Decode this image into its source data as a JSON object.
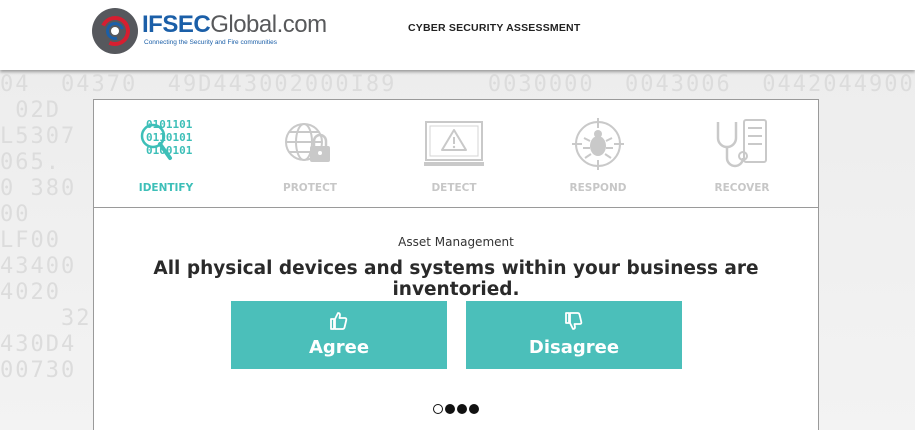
{
  "header": {
    "logo_brand": "IFSEC",
    "logo_rest": "Global.com",
    "logo_tagline": "Connecting the Security and Fire communities",
    "title": "CYBER SECURITY ASSESSMENT"
  },
  "steps": [
    {
      "label": "IDENTIFY",
      "icon": "binary-magnifier-icon",
      "active": true
    },
    {
      "label": "PROTECT",
      "icon": "globe-lock-icon",
      "active": false
    },
    {
      "label": "DETECT",
      "icon": "monitor-warning-icon",
      "active": false
    },
    {
      "label": "RESPOND",
      "icon": "bug-target-icon",
      "active": false
    },
    {
      "label": "RECOVER",
      "icon": "stethoscope-server-icon",
      "active": false
    }
  ],
  "question": {
    "category": "Asset Management",
    "statement": "All physical devices and systems within your business are inventoried."
  },
  "buttons": {
    "agree": "Agree",
    "disagree": "Disagree"
  },
  "pagination": {
    "total": 4,
    "current": 1
  },
  "colors": {
    "accent": "#4bbfba",
    "active_step": "#3dbfb8",
    "inactive_step": "#c7c7c7",
    "brand_blue": "#1b5fa8",
    "brand_red": "#d71e30"
  }
}
